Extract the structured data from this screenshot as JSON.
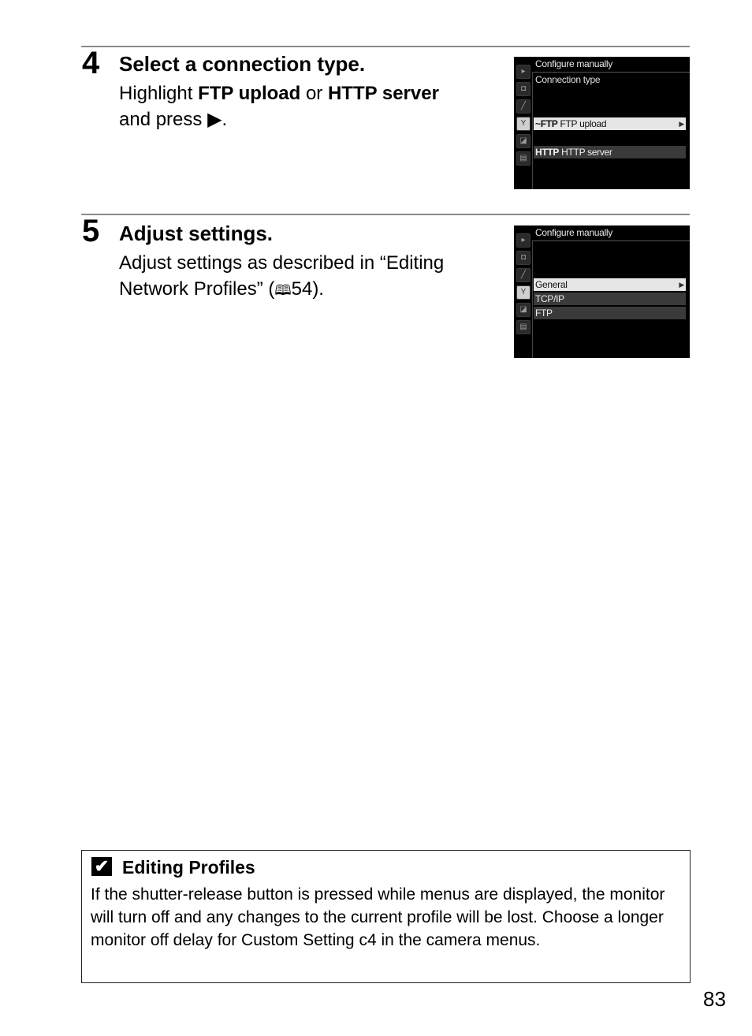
{
  "steps": [
    {
      "number": "4",
      "title": "Select a connection type.",
      "body": {
        "t1": "Highlight ",
        "b1": "FTP upload",
        "t2": " or ",
        "b2": "HTTP server",
        "t3": " and press ",
        "arrow": "▶",
        "t4": "."
      },
      "screen": {
        "header": "Configure manually",
        "subheader": "Connection type",
        "tabs": [
          "playback-icon",
          "camera-icon",
          "pencil-icon",
          "wrench-icon",
          "retouch-icon",
          "my-menu-icon"
        ],
        "active_tab": 3,
        "items": [
          {
            "icon": "~FTP",
            "label": "FTP upload",
            "state": "selected",
            "arrow": "▶"
          },
          {
            "icon": "HTTP",
            "label": "HTTP server",
            "state": "normal"
          }
        ]
      }
    },
    {
      "number": "5",
      "title": "Adjust settings.",
      "body": {
        "t1": "Adjust settings as described in “Editing Network Profiles” (",
        "ref_icon": "🕮",
        "ref": "54",
        "t2": ")."
      },
      "screen": {
        "header": "Configure manually",
        "tabs": [
          "playback-icon",
          "camera-icon",
          "pencil-icon",
          "wrench-icon",
          "retouch-icon",
          "my-menu-icon"
        ],
        "active_tab": 3,
        "items": [
          {
            "label": "General",
            "state": "selected",
            "arrow": "▶"
          },
          {
            "label": "TCP/IP",
            "state": "normal"
          },
          {
            "label": "FTP",
            "state": "normal"
          }
        ]
      }
    }
  ],
  "note": {
    "icon": "check-mark-icon",
    "icon_glyph": "✔",
    "title": "Editing Profiles",
    "body": "If the shutter-release button is pressed while menus are displayed, the monitor will turn off and any changes to the current profile will be lost. Choose a longer monitor off delay for Custom Setting c4 in the camera menus."
  },
  "page_number": "83"
}
